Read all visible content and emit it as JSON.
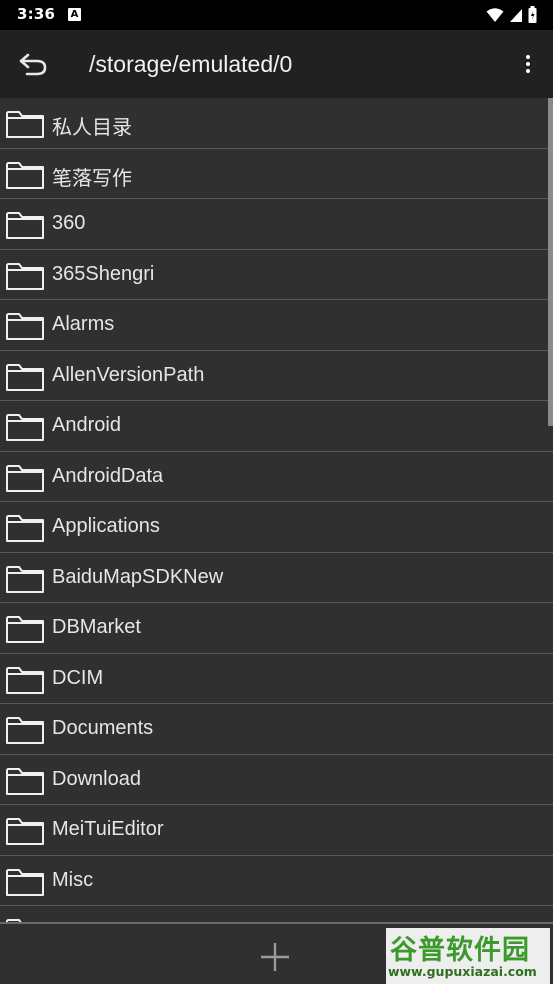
{
  "status_bar": {
    "time": "3:36",
    "notification_badge": "A"
  },
  "toolbar": {
    "title": "/storage/emulated/0",
    "back_icon": "back-arrow-icon",
    "menu_icon": "more-vert-icon"
  },
  "folders": [
    {
      "name": "私人目录"
    },
    {
      "name": "笔落写作"
    },
    {
      "name": "360"
    },
    {
      "name": "365Shengri"
    },
    {
      "name": "Alarms"
    },
    {
      "name": "AllenVersionPath"
    },
    {
      "name": "Android"
    },
    {
      "name": "AndroidData"
    },
    {
      "name": "Applications"
    },
    {
      "name": "BaiduMapSDKNew"
    },
    {
      "name": "DBMarket"
    },
    {
      "name": "DCIM"
    },
    {
      "name": "Documents"
    },
    {
      "name": "Download"
    },
    {
      "name": "MeiTuiEditor"
    },
    {
      "name": "Misc"
    },
    {
      "name": ""
    }
  ],
  "bottom_bar": {
    "add_icon": "plus-icon"
  },
  "watermark": {
    "title": "谷普软件园",
    "url": "www.gupuxiazai.com"
  },
  "colors": {
    "list_bg": "#303030",
    "toolbar_bg": "#212121",
    "watermark_green": "#3a9a2a"
  }
}
